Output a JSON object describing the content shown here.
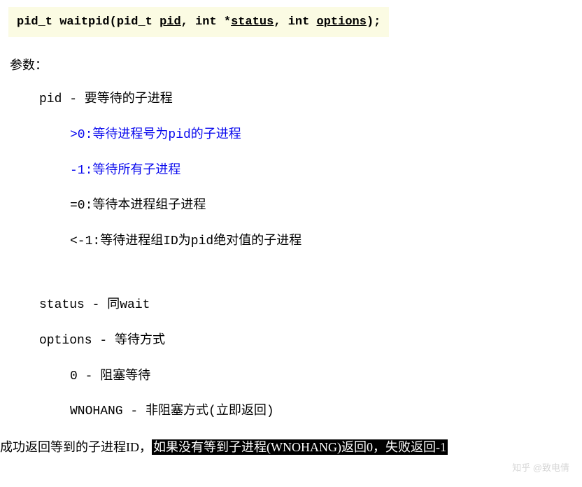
{
  "signature": {
    "ret_type": "pid_t",
    "fn_name": "waitpid",
    "arg1_type": "pid_t",
    "arg1_name": "pid",
    "arg2_type": "int *",
    "arg2_name": "status",
    "arg3_type": "int",
    "arg3_name": "options",
    "tail": ");"
  },
  "labels": {
    "params": "参数：",
    "pid_desc": "pid - 要等待的子进程",
    "pid_gt0": ">0:等待进程号为pid的子进程",
    "pid_neg1": "-1:等待所有子进程",
    "pid_eq0": "=0:等待本进程组子进程",
    "pid_lt_neg1": "<-1:等待进程组ID为pid绝对值的子进程",
    "status_desc": "status - 同wait",
    "options_desc": "options - 等待方式",
    "opt_0": "0 - 阻塞等待",
    "opt_wnohang": "WNOHANG - 非阻塞方式(立即返回)",
    "bottom_prefix": "成功返回等到的子进程ID，",
    "bottom_highlight": "如果没有等到子进程(WNOHANG)返回0，失败返回-1",
    "watermark": "知乎 @致电倩"
  }
}
